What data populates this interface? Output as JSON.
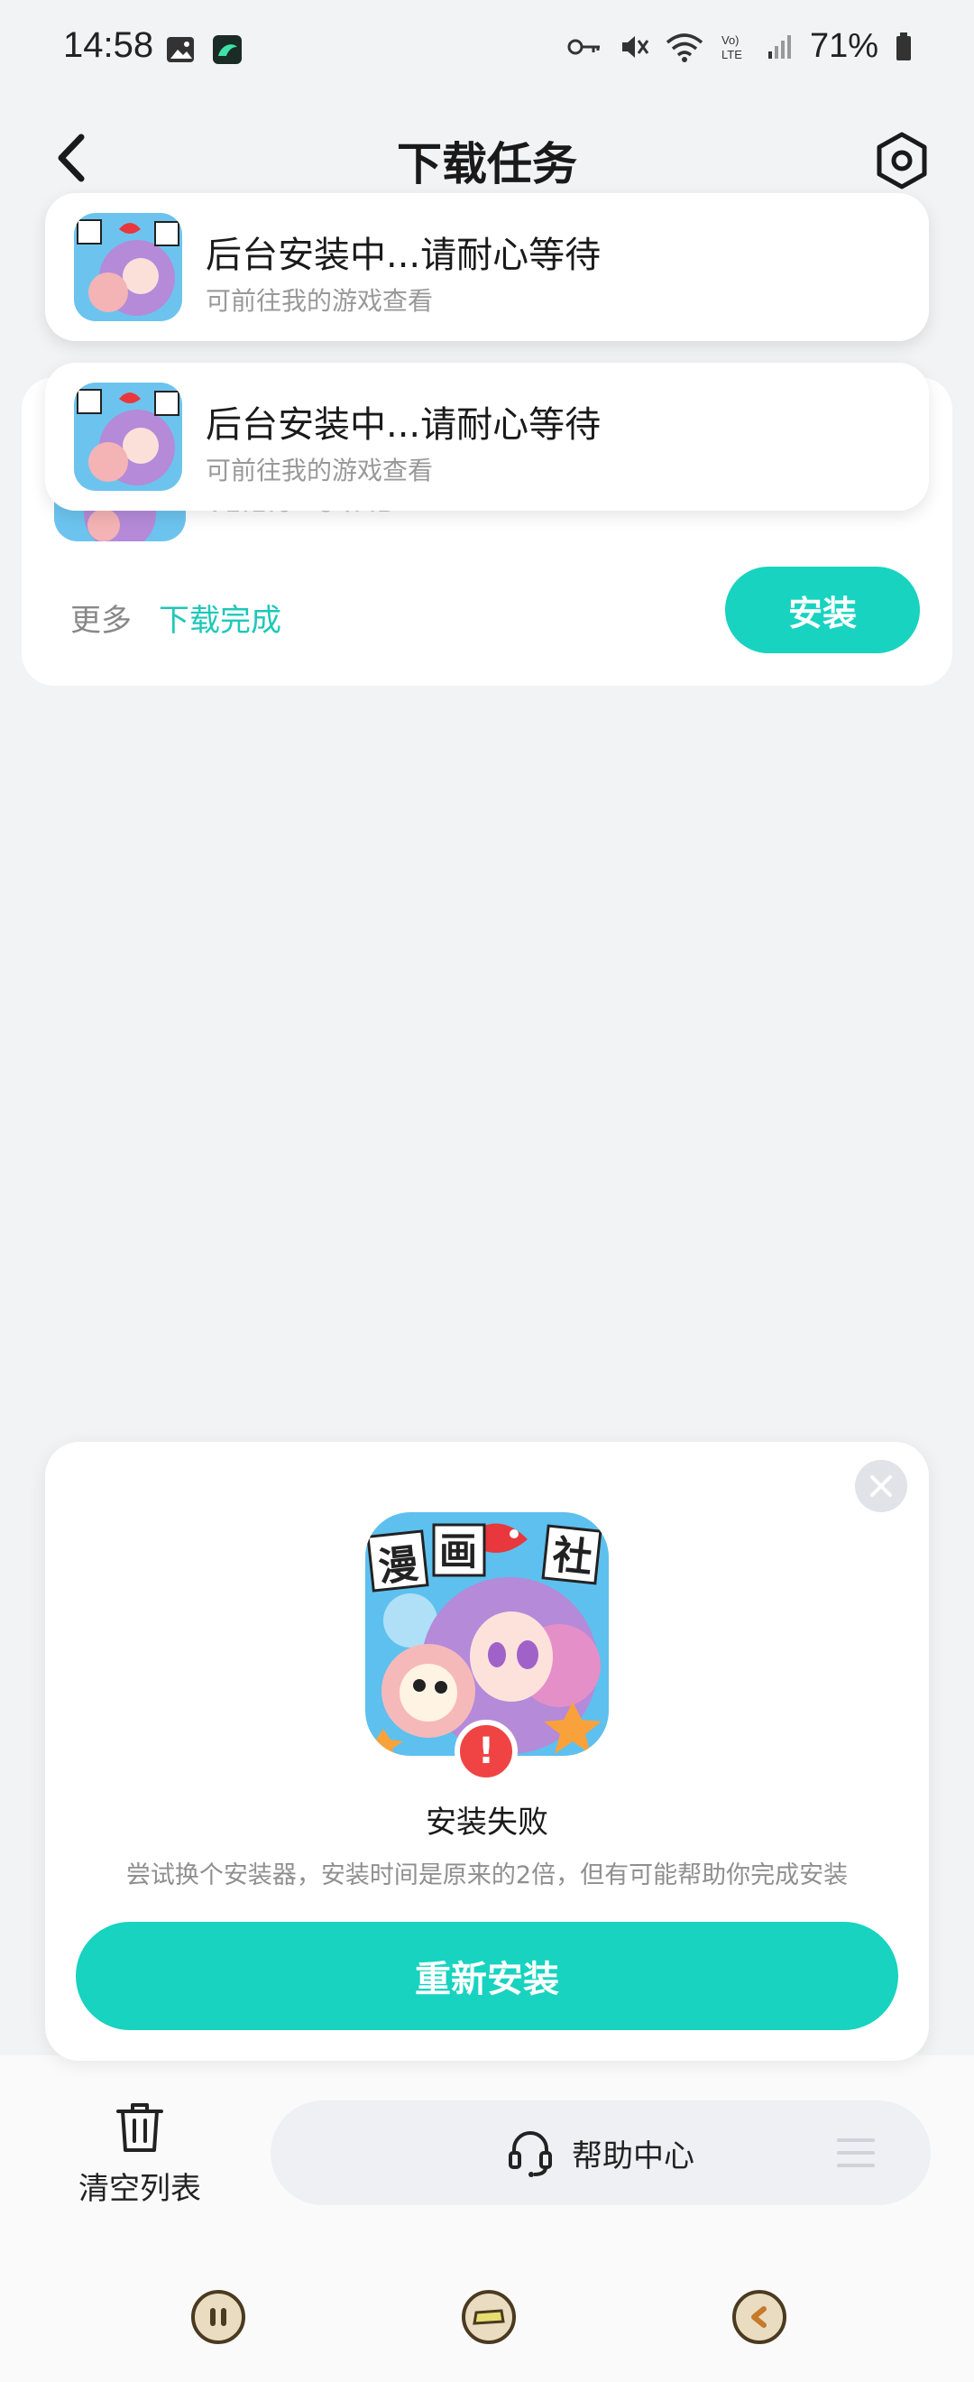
{
  "status_bar": {
    "time": "14:58",
    "battery": "71%",
    "icons_left": [
      "gallery-icon",
      "app-notification-icon"
    ],
    "icons_right": [
      "key-icon",
      "mute-icon",
      "wifi-icon",
      "volte-icon",
      "signal-icon",
      "battery-icon"
    ]
  },
  "header": {
    "title": "下载任务"
  },
  "task_card": {
    "meta_text": "V1.1.0 · 94MB",
    "more_label": "更多",
    "status_label": "下载完成",
    "install_label": "安装"
  },
  "toasts": [
    {
      "title": "后台安装中...请耐心等待",
      "subtitle": "可前往我的游戏查看"
    },
    {
      "title": "后台安装中...请耐心等待",
      "subtitle": "可前往我的游戏查看"
    }
  ],
  "modal": {
    "title": "安装失败",
    "description": "尝试换个安装器，安装时间是原来的2倍，但有可能帮助你完成安装",
    "reinstall_label": "重新安装",
    "badge": "!",
    "app_logo_text": [
      "漫",
      "画",
      "社"
    ]
  },
  "toolbar": {
    "clear_label": "清空列表",
    "help_label": "帮助中心"
  },
  "colors": {
    "accent": "#17d3c0",
    "error": "#f04444",
    "background": "#f2f3f5"
  }
}
